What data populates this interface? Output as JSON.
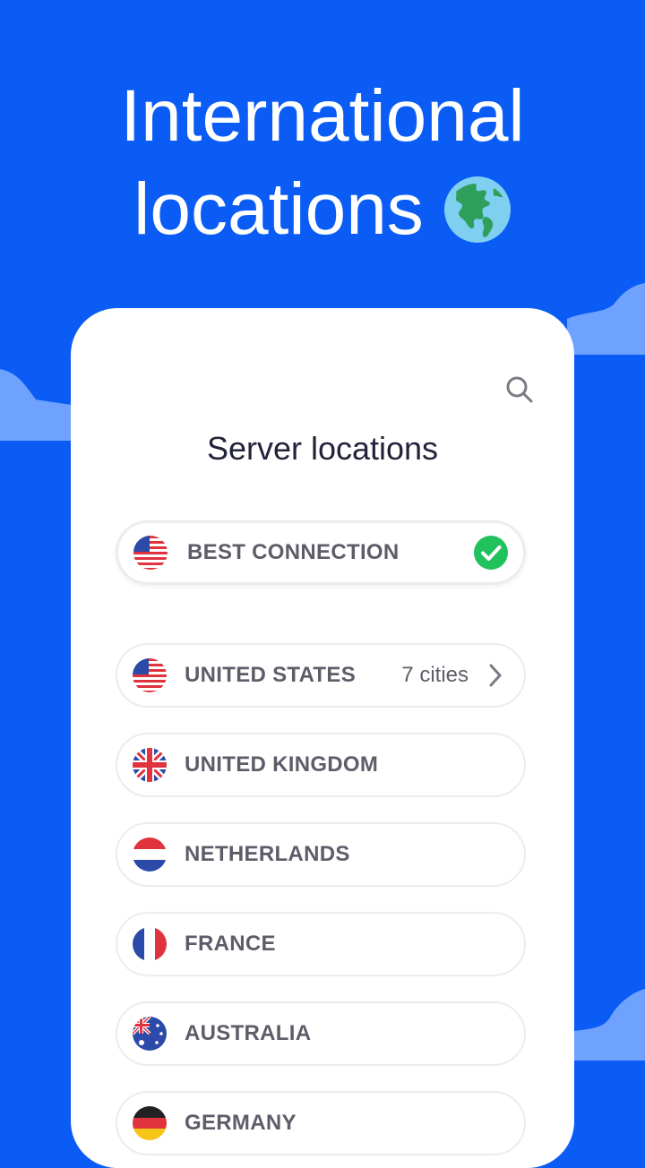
{
  "headline": {
    "line1": "International",
    "line2": "locations"
  },
  "screen": {
    "title": "Server locations",
    "search_icon": "search-icon",
    "best": {
      "label": "BEST CONNECTION",
      "flag": "us-flag-icon",
      "status_icon": "check-circle-icon",
      "status_color": "#21c25e"
    },
    "countries": [
      {
        "label": "UNITED STATES",
        "flag": "us-flag-icon",
        "cities": "7 cities"
      },
      {
        "label": "UNITED KINGDOM",
        "flag": "uk-flag-icon"
      },
      {
        "label": "NETHERLANDS",
        "flag": "nl-flag-icon"
      },
      {
        "label": "FRANCE",
        "flag": "fr-flag-icon"
      },
      {
        "label": "AUSTRALIA",
        "flag": "au-flag-icon"
      },
      {
        "label": "GERMANY",
        "flag": "de-flag-icon"
      }
    ]
  },
  "colors": {
    "background": "#0a5cf5",
    "cloud": "#6fa2ff",
    "card": "#ffffff",
    "text": "#5d5d69"
  }
}
